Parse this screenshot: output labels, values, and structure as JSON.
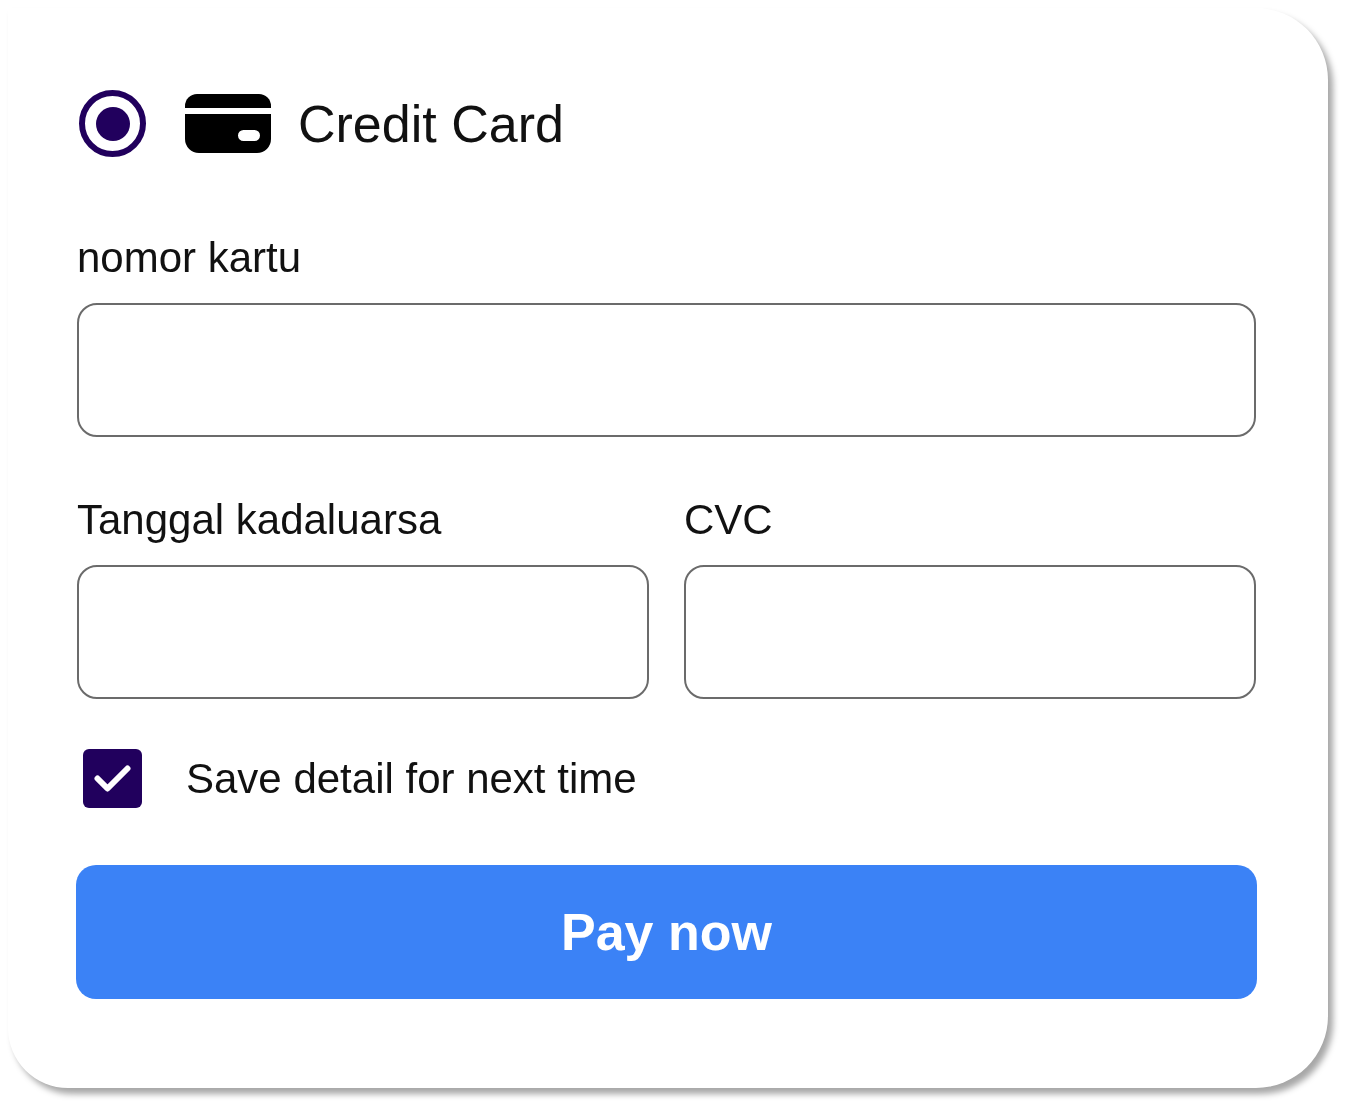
{
  "payment_method": {
    "label": "Credit Card",
    "selected": true
  },
  "fields": [
    {
      "label": "nomor kartu"
    },
    {
      "label": "Tanggal kadaluarsa"
    },
    {
      "label": "CVC"
    }
  ],
  "save_detail": {
    "label": "Save detail for next time",
    "checked": true
  },
  "submit_button": {
    "label": "Pay now"
  }
}
